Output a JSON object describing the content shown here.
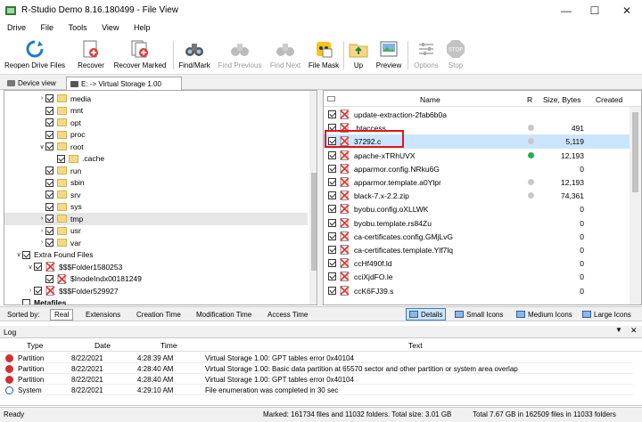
{
  "window": {
    "title": "R-Studio Demo 8.16.180499 - File View"
  },
  "menu": [
    "Drive",
    "File",
    "Tools",
    "View",
    "Help"
  ],
  "toolbar": [
    {
      "label": "Reopen Drive Files",
      "icon": "reopen-drive-icon",
      "enabled": true
    },
    {
      "label": "Recover",
      "icon": "recover-icon",
      "enabled": true
    },
    {
      "label": "Recover Marked",
      "icon": "recover-marked-icon",
      "enabled": true
    },
    {
      "label": "Find/Mark",
      "icon": "binoculars-icon",
      "enabled": true
    },
    {
      "label": "Find Previous",
      "icon": "find-previous-icon",
      "enabled": false
    },
    {
      "label": "Find Next",
      "icon": "find-next-icon",
      "enabled": false
    },
    {
      "label": "File Mask",
      "icon": "file-mask-icon",
      "enabled": true
    },
    {
      "label": "Up",
      "icon": "folder-up-icon",
      "enabled": true
    },
    {
      "label": "Preview",
      "icon": "preview-icon",
      "enabled": true
    },
    {
      "label": "Options",
      "icon": "options-icon",
      "enabled": false
    },
    {
      "label": "Stop",
      "icon": "stop-icon",
      "enabled": false
    }
  ],
  "tabs": {
    "device_view": "Device view",
    "virtual_storage": "E: -> Virtual Storage 1.00"
  },
  "tree": [
    {
      "label": "media",
      "indent": 2,
      "chevron": ">",
      "icon": "folder",
      "checked": true
    },
    {
      "label": "mnt",
      "indent": 2,
      "chevron": "",
      "icon": "folder",
      "checked": true
    },
    {
      "label": "opt",
      "indent": 2,
      "chevron": "",
      "icon": "folder",
      "checked": true
    },
    {
      "label": "proc",
      "indent": 2,
      "chevron": "",
      "icon": "folder",
      "checked": true
    },
    {
      "label": "root",
      "indent": 2,
      "chevron": "v",
      "icon": "folder",
      "checked": true
    },
    {
      "label": ".cache",
      "indent": 3,
      "chevron": "",
      "icon": "folder",
      "checked": true
    },
    {
      "label": "run",
      "indent": 2,
      "chevron": "",
      "icon": "folder",
      "checked": true
    },
    {
      "label": "sbin",
      "indent": 2,
      "chevron": "",
      "icon": "folder",
      "checked": true
    },
    {
      "label": "srv",
      "indent": 2,
      "chevron": "",
      "icon": "folder",
      "checked": true
    },
    {
      "label": "sys",
      "indent": 2,
      "chevron": "",
      "icon": "folder",
      "checked": true
    },
    {
      "label": "tmp",
      "indent": 2,
      "chevron": ">",
      "icon": "folder",
      "checked": true,
      "selected": true
    },
    {
      "label": "usr",
      "indent": 2,
      "chevron": ">",
      "icon": "folder",
      "checked": true
    },
    {
      "label": "var",
      "indent": 2,
      "chevron": ">",
      "icon": "folder",
      "checked": true
    },
    {
      "label": "Extra Found Files",
      "indent": 0,
      "chevron": "v",
      "icon": "none",
      "checked": true
    },
    {
      "label": "$$$Folder1580253",
      "indent": 1,
      "chevron": "v",
      "icon": "deleted",
      "checked": true
    },
    {
      "label": "$InodeIndx00181249",
      "indent": 2,
      "chevron": "",
      "icon": "deleted",
      "checked": true
    },
    {
      "label": "$$$Folder529927",
      "indent": 1,
      "chevron": ">",
      "icon": "deleted",
      "checked": true
    },
    {
      "label": "Metafiles",
      "indent": 0,
      "chevron": "",
      "icon": "none",
      "checked": false,
      "bold": true
    }
  ],
  "file_columns": {
    "name": "Name",
    "r": "R",
    "size": "Size, Bytes",
    "created": "Created"
  },
  "files": [
    {
      "name": "update-extraction-2fab6b0a",
      "size": "",
      "dot": ""
    },
    {
      "name": ".htaccess",
      "size": "491",
      "dot": "#c8c8c8"
    },
    {
      "name": "37292.c",
      "size": "5,119",
      "dot": "#c8c8c8",
      "selected": true
    },
    {
      "name": "apache-xTRhUVX",
      "size": "12,193",
      "dot": "#22b14c"
    },
    {
      "name": "apparmor.config.NRku6G",
      "size": "0",
      "dot": ""
    },
    {
      "name": "apparmor.template.a0Ylpr",
      "size": "12,193",
      "dot": "#c8c8c8"
    },
    {
      "name": "black-7.x-2.2.zip",
      "size": "74,361",
      "dot": "#c8c8c8"
    },
    {
      "name": "byobu.config.oXLLWK",
      "size": "0",
      "dot": ""
    },
    {
      "name": "byobu.template.rs84Zu",
      "size": "0",
      "dot": ""
    },
    {
      "name": "ca-certificates.config.GMjLvG",
      "size": "0",
      "dot": ""
    },
    {
      "name": "ca-certificates.template.Ylf7lq",
      "size": "0",
      "dot": ""
    },
    {
      "name": "ccHf490f.ld",
      "size": "0",
      "dot": ""
    },
    {
      "name": "cciXjdFO.le",
      "size": "0",
      "dot": ""
    },
    {
      "name": "ccK6FJ39.s",
      "size": "0",
      "dot": ""
    }
  ],
  "sortbar": {
    "label": "Sorted by:",
    "options": [
      "Real",
      "Extensions",
      "Creation Time",
      "Modification Time",
      "Access Time"
    ],
    "active": "Real",
    "views": [
      "Details",
      "Small Icons",
      "Medium Icons",
      "Large Icons"
    ],
    "active_view": "Details"
  },
  "log": {
    "title": "Log",
    "columns": {
      "type": "Type",
      "date": "Date",
      "time": "Time",
      "text": "Text"
    },
    "rows": [
      {
        "type": "Partition",
        "date": "8/22/2021",
        "time": "4:28:39 AM",
        "text": "Virtual Storage 1.00: GPT tables error 0x40104",
        "icon": "error"
      },
      {
        "type": "Partition",
        "date": "8/22/2021",
        "time": "4:28:40 AM",
        "text": "Virtual Storage 1.00: Basic data partition at 65570 sector and other partition or system area overlap",
        "icon": "error"
      },
      {
        "type": "Partition",
        "date": "8/22/2021",
        "time": "4:28:40 AM",
        "text": "Virtual Storage 1.00: GPT tables error 0x40104",
        "icon": "error"
      },
      {
        "type": "System",
        "date": "8/22/2021",
        "time": "4:29:10 AM",
        "text": "File enumeration was completed in 30 sec",
        "icon": "info"
      }
    ]
  },
  "status": {
    "ready": "Ready",
    "marked": "Marked: 161734 files and 11032 folders. Total size: 3.01 GB",
    "total": "Total 7.67 GB in 162509 files in 11033 folders"
  }
}
